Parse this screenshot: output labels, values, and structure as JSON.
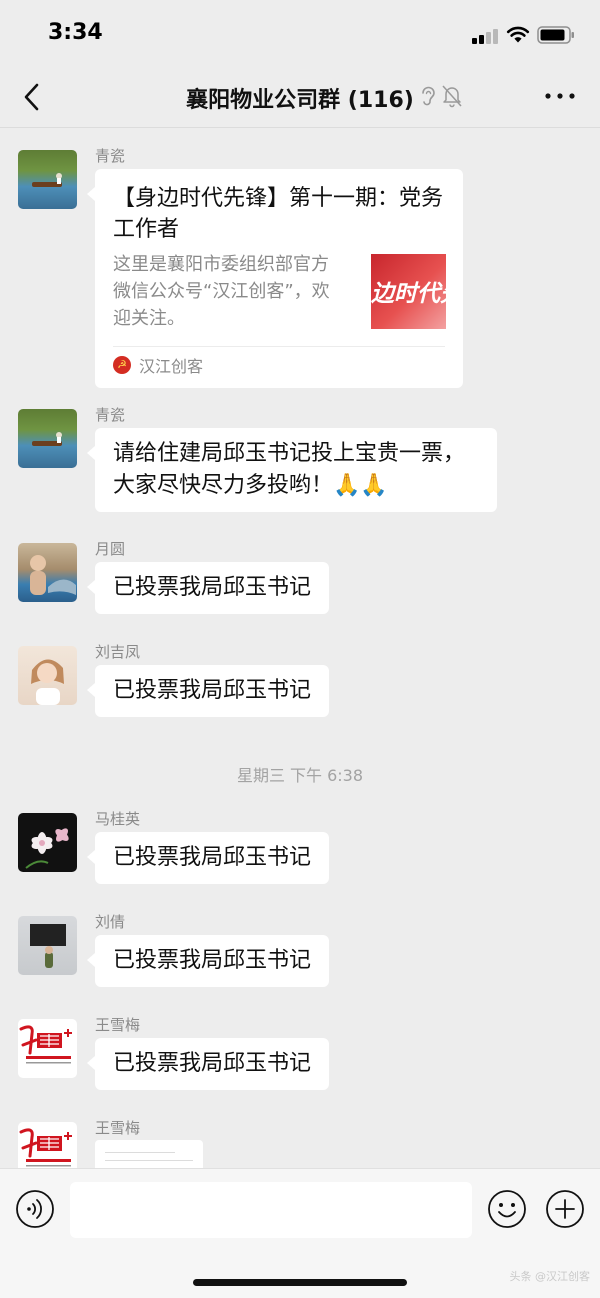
{
  "status_bar": {
    "time": "3:34",
    "icons": [
      "signal-icon",
      "wifi-icon",
      "battery-icon"
    ]
  },
  "nav": {
    "title": "襄阳物业公司群 (116)",
    "icons": [
      "back-icon",
      "ear-icon",
      "mute-bell-icon",
      "more-icon"
    ]
  },
  "messages": [
    {
      "sender": "青瓷",
      "type": "link",
      "title": "【身边时代先锋】第十一期：党务工作者",
      "desc": "这里是襄阳市委组织部官方微信公众号“汉江创客”，欢迎关注。",
      "thumb_text": "边时代先",
      "source": "汉江创客"
    },
    {
      "sender": "青瓷",
      "type": "text",
      "text": "请给住建局邱玉书记投上宝贵一票，大家尽快尽力多投哟！🙏🙏"
    },
    {
      "sender": "月圆",
      "type": "text",
      "text": "已投票我局邱玉书记"
    },
    {
      "sender": "刘吉凤",
      "type": "text",
      "text": "已投票我局邱玉书记"
    },
    {
      "type": "time",
      "text": "星期三 下午 6:38"
    },
    {
      "sender": "马桂英",
      "type": "text",
      "text": "已投票我局邱玉书记"
    },
    {
      "sender": "刘倩",
      "type": "text",
      "text": "已投票我局邱玉书记"
    },
    {
      "sender": "王雪梅",
      "type": "text",
      "text": "已投票我局邱玉书记"
    },
    {
      "sender": "王雪梅",
      "type": "image"
    }
  ],
  "avatar_brand": {
    "main": "红管家",
    "sub": "红色物业 服务暖心"
  },
  "colors": {
    "background": "#ededed",
    "bubble": "#ffffff",
    "meta_text": "#8a8a8a",
    "brand_red": "#d0151f"
  },
  "input_bar": {
    "placeholder": "",
    "icons": [
      "voice-icon",
      "emoji-icon",
      "plus-icon"
    ]
  },
  "watermark": "头条 @汉江创客"
}
